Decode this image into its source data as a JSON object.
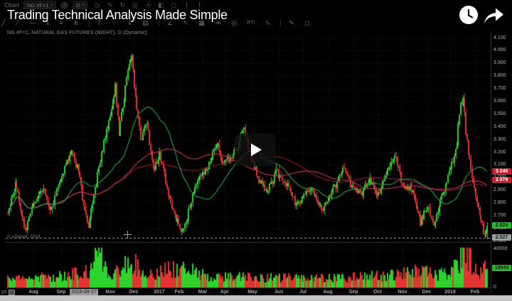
{
  "video": {
    "title": "Trading Technical Analysis Made Simple"
  },
  "app": {
    "menu_label": "Chart",
    "symbol_value": "NG #F=1",
    "interval_value": "D",
    "caret_glyph": "▾",
    "lookup_glyph": "◔",
    "symbol_description": "NG #F=1, NATURAL GAS FUTURES (NIGHT), D (Dynamic)",
    "watermark": "© eSignal, 2018",
    "period_label": "ys",
    "toolbar_icons": [
      {
        "name": "clock-icon",
        "glyph": "◷"
      },
      {
        "name": "pencil-icon",
        "glyph": "✎"
      },
      {
        "name": "redo-icon",
        "glyph": "↻"
      },
      {
        "name": "bullseye-icon",
        "glyph": "◎"
      },
      {
        "name": "annotation-icon",
        "glyph": "Ⓐ"
      },
      {
        "name": "highlighter-icon",
        "glyph": "◧"
      },
      {
        "name": "comment-icon",
        "glyph": "◻"
      },
      {
        "name": "twitter-icon",
        "glyph": "t"
      },
      {
        "name": "facebook-icon",
        "glyph": "f"
      }
    ],
    "drawing_icons": [
      {
        "name": "trendline-tool-icon",
        "glyph": "╱"
      },
      {
        "name": "ray-tool-icon",
        "glyph": "⟋"
      },
      {
        "name": "horizontal-line-tool-icon",
        "glyph": "—"
      },
      {
        "name": "vertical-line-tool-icon",
        "glyph": "ǁ"
      },
      {
        "name": "parallel-channel-tool-icon",
        "glyph": "≡"
      },
      {
        "name": "pitchfork-tool-icon",
        "glyph": "⋔"
      },
      {
        "name": "divider",
        "glyph": ""
      },
      {
        "name": "text-tool-icon",
        "glyph": "T"
      },
      {
        "name": "callout-tool-icon",
        "glyph": "♢"
      },
      {
        "name": "arrow-down-marker-tool-icon",
        "glyph": "↧"
      },
      {
        "name": "rectangle-tool-icon",
        "glyph": "▤"
      },
      {
        "name": "divider",
        "glyph": ""
      },
      {
        "name": "angle-tool-icon",
        "glyph": "∠"
      },
      {
        "name": "arrow-tool-icon",
        "glyph": "↖"
      },
      {
        "name": "grid-tool-icon",
        "glyph": "▦"
      },
      {
        "name": "fibonacci-tool-icon",
        "glyph": "≔"
      },
      {
        "name": "ellipse-tool-icon",
        "glyph": "◎"
      },
      {
        "name": "pti-tool-icon",
        "glyph": "PTI"
      },
      {
        "name": "wave-tool-icon",
        "glyph": "∿"
      },
      {
        "name": "divider",
        "glyph": ""
      },
      {
        "name": "note-tool-icon",
        "glyph": "✎"
      },
      {
        "name": "chat-tool-icon",
        "glyph": "◻"
      }
    ]
  },
  "chart_data": {
    "type": "candlestick",
    "symbol": "NG #F=1",
    "description": "NATURAL GAS FUTURES (NIGHT)",
    "interval": "D (Dynamic)",
    "ylim": [
      2.493,
      4.12
    ],
    "price_ticks": [
      4.1,
      4.0,
      3.9,
      3.8,
      3.7,
      3.6,
      3.5,
      3.4,
      3.3,
      3.2,
      3.1,
      3.0,
      2.9,
      2.8,
      2.7,
      2.6,
      2.5
    ],
    "volume_max": 42000,
    "volume_ticks": [
      40000,
      0
    ],
    "months": [
      {
        "label": "Aug",
        "x": 47
      },
      {
        "label": "Sep",
        "x": 86
      },
      {
        "label": "2016-09-27",
        "x": 118,
        "badge": true
      },
      {
        "label": "Nov",
        "x": 155
      },
      {
        "label": "Dec",
        "x": 188
      },
      {
        "label": "2017",
        "x": 224
      },
      {
        "label": "Feb",
        "x": 252
      },
      {
        "label": "Mar",
        "x": 285
      },
      {
        "label": "Apr",
        "x": 316
      },
      {
        "label": "May",
        "x": 355
      },
      {
        "label": "Jun",
        "x": 392
      },
      {
        "label": "Jul",
        "x": 426
      },
      {
        "label": "Aug",
        "x": 461
      },
      {
        "label": "Sep",
        "x": 497
      },
      {
        "label": "Oct",
        "x": 531
      },
      {
        "label": "Nov",
        "x": 566
      },
      {
        "label": "Dec",
        "x": 600
      },
      {
        "label": "2018",
        "x": 633
      },
      {
        "label": "Feb",
        "x": 668
      }
    ],
    "price_anchors": [
      [
        0,
        2.72
      ],
      [
        6,
        2.95
      ],
      [
        14,
        2.58
      ],
      [
        20,
        2.78
      ],
      [
        28,
        2.92
      ],
      [
        34,
        2.74
      ],
      [
        40,
        2.95
      ],
      [
        50,
        3.2
      ],
      [
        56,
        3.05
      ],
      [
        60,
        2.78
      ],
      [
        64,
        2.62
      ],
      [
        72,
        3.1
      ],
      [
        80,
        3.45
      ],
      [
        85,
        3.72
      ],
      [
        88,
        3.35
      ],
      [
        95,
        3.88
      ],
      [
        98,
        3.95
      ],
      [
        100,
        3.7
      ],
      [
        105,
        3.3
      ],
      [
        110,
        3.45
      ],
      [
        115,
        3.05
      ],
      [
        120,
        3.18
      ],
      [
        125,
        2.95
      ],
      [
        132,
        2.7
      ],
      [
        138,
        2.56
      ],
      [
        140,
        2.62
      ],
      [
        148,
        2.95
      ],
      [
        155,
        3.05
      ],
      [
        160,
        3.12
      ],
      [
        165,
        3.28
      ],
      [
        170,
        3.1
      ],
      [
        180,
        3.2
      ],
      [
        186,
        3.4
      ],
      [
        193,
        3.15
      ],
      [
        200,
        2.95
      ],
      [
        205,
        2.88
      ],
      [
        212,
        3.05
      ],
      [
        220,
        2.95
      ],
      [
        228,
        2.78
      ],
      [
        240,
        2.92
      ],
      [
        248,
        2.75
      ],
      [
        260,
        2.95
      ],
      [
        266,
        3.08
      ],
      [
        272,
        2.92
      ],
      [
        280,
        2.88
      ],
      [
        286,
        3.0
      ],
      [
        292,
        2.85
      ],
      [
        300,
        3.05
      ],
      [
        306,
        3.18
      ],
      [
        312,
        2.95
      ],
      [
        320,
        2.9
      ],
      [
        326,
        2.65
      ],
      [
        332,
        2.78
      ],
      [
        336,
        2.62
      ],
      [
        340,
        2.75
      ],
      [
        348,
        3.0
      ],
      [
        354,
        3.2
      ],
      [
        358,
        3.6
      ],
      [
        360,
        3.63
      ],
      [
        362,
        3.35
      ],
      [
        366,
        3.05
      ],
      [
        370,
        2.85
      ],
      [
        374,
        2.65
      ],
      [
        377,
        2.55
      ],
      [
        379,
        2.62
      ]
    ],
    "volume_anchors": [
      [
        0,
        9000
      ],
      [
        40,
        11000
      ],
      [
        64,
        16000
      ],
      [
        73,
        38000
      ],
      [
        80,
        13000
      ],
      [
        98,
        26000
      ],
      [
        110,
        14000
      ],
      [
        138,
        22000
      ],
      [
        160,
        11000
      ],
      [
        200,
        10000
      ],
      [
        240,
        9500
      ],
      [
        280,
        10500
      ],
      [
        306,
        13000
      ],
      [
        326,
        17000
      ],
      [
        340,
        12000
      ],
      [
        354,
        20000
      ],
      [
        358,
        30000
      ],
      [
        362,
        39000
      ],
      [
        368,
        22000
      ],
      [
        374,
        16000
      ],
      [
        379,
        19543
      ]
    ],
    "badges": [
      {
        "label": "3.046",
        "price": 3.046,
        "color": "red"
      },
      {
        "label": "2.979",
        "price": 2.979,
        "color": "red"
      },
      {
        "label": "2.624",
        "price": 2.624,
        "color": "green"
      },
      {
        "label": "2.527",
        "price": 2.527,
        "color": "gray"
      }
    ],
    "ref_line_price": 2.527,
    "last_price": 2.624,
    "volume_badge": {
      "label": "19543",
      "value": 19543,
      "color": "green"
    },
    "moving_averages": [
      {
        "window": 140,
        "color": "#8f2136"
      },
      {
        "window": 90,
        "color": "#cf3b52"
      },
      {
        "window": 35,
        "color": "#2fa34d"
      }
    ],
    "colors": {
      "up": "#2fd32f",
      "down": "#e23434",
      "grid": "#1e1e1e",
      "separator": "#2d2d2d",
      "axis_text": "#b2b2b2",
      "ref_line": "#a9afaf"
    }
  }
}
